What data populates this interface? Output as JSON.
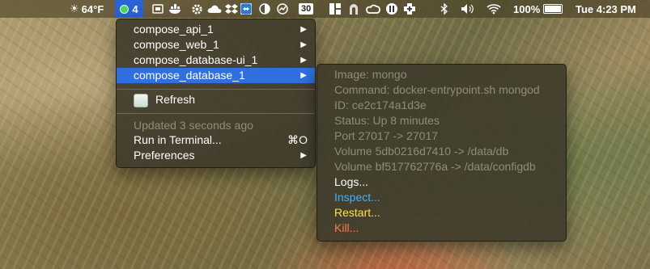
{
  "menubar": {
    "temperature": "64°F",
    "docker_count": "4",
    "calendar_badge": "30",
    "battery_percent": "100%",
    "battery_level": 1.0,
    "clock": "Tue 4:23 PM"
  },
  "menu": {
    "items": [
      {
        "label": "compose_api_1"
      },
      {
        "label": "compose_web_1"
      },
      {
        "label": "compose_database-ui_1"
      },
      {
        "label": "compose_database_1"
      }
    ],
    "refresh_label": "Refresh",
    "updated_text": "Updated 3 seconds ago",
    "run_label": "Run in Terminal...",
    "run_shortcut": "⌘O",
    "preferences_label": "Preferences"
  },
  "submenu": {
    "image": "Image: mongo",
    "command": "Command: docker-entrypoint.sh mongod",
    "id": "ID: ce2c174a1d3e",
    "status": "Status: Up 8 minutes",
    "port": "Port 27017 -> 27017",
    "volume1": "Volume 5db0216d7410 -> /data/db",
    "volume2": "Volume bf517762776a -> /data/configdb",
    "logs": "Logs...",
    "inspect": "Inspect...",
    "restart": "Restart...",
    "kill": "Kill..."
  },
  "colors": {
    "selection": "#2f6fe0",
    "inspect": "#48aff5",
    "restart": "#ffe43a",
    "kill": "#ff7a4a",
    "docker_status": "#4ad95a"
  }
}
